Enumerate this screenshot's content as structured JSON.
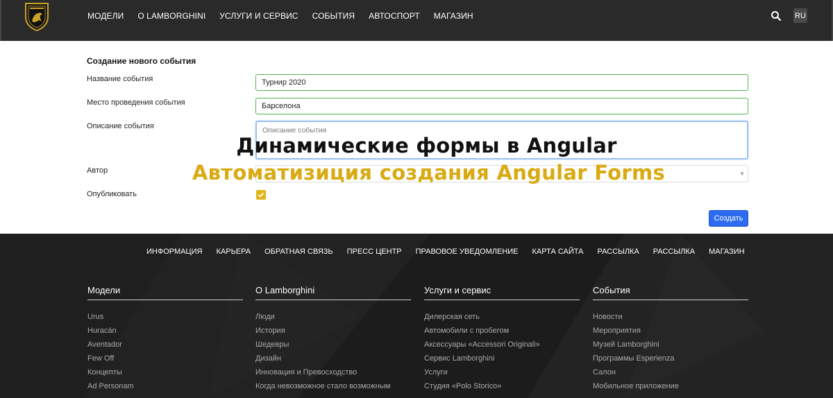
{
  "header": {
    "nav": [
      "МОДЕЛИ",
      "О LAMBORGHINI",
      "УСЛУГИ И СЕРВИС",
      "СОБЫТИЯ",
      "АВТОСПОРТ",
      "МАГАЗИН"
    ],
    "lang": "RU"
  },
  "form": {
    "title": "Создание нового события",
    "name_label": "Название события",
    "name_value": "Турнир 2020",
    "place_label": "Место проведения события",
    "place_value": "Барселона",
    "desc_label": "Описание события",
    "desc_placeholder": "Описание события",
    "author_label": "Автор",
    "publish_label": "Опубликовать",
    "publish_checked": true,
    "submit_label": "Создать"
  },
  "overlay": {
    "title": "Динамические формы в Angular",
    "subtitle": "Автоматизиция создания Angular Forms"
  },
  "footer": {
    "nav": [
      "ИНФОРМАЦИЯ",
      "КАРЬЕРА",
      "ОБРАТНАЯ СВЯЗЬ",
      "ПРЕСС ЦЕНТР",
      "ПРАВОВОЕ УВЕДОМЛЕНИЕ",
      "КАРТА САЙТА",
      "РАССЫЛКА",
      "РАССЫЛКА",
      "МАГАЗИН"
    ],
    "columns": [
      {
        "title": "Модели",
        "items": [
          "Urus",
          "Huracán",
          "Aventador",
          "Few Off",
          "Концепты",
          "Ad Personam"
        ]
      },
      {
        "title": "О Lamborghini",
        "items": [
          "Люди",
          "История",
          "Шедевры",
          "Дизайн",
          "Инновация и Превосходство",
          "Когда невозможное стало возможным"
        ]
      },
      {
        "title": "Услуги и сервис",
        "items": [
          "Дилерская сеть",
          "Автомобили с пробегом",
          "Аксессуары «Accessori Originali»",
          "Сервис Lamborghini",
          "Услуги",
          "Студия «Polo Storico»"
        ]
      },
      {
        "title": "События",
        "items": [
          "Новости",
          "Мероприятия",
          "Музей Lamborghini",
          "Программы Esperienza",
          "Салон",
          "Мобильное приложение"
        ]
      }
    ]
  },
  "colors": {
    "header_bg": "#2a2a2a",
    "accent_gold": "#d9aa12",
    "valid_border": "#52b452",
    "submit_blue": "#2d6cf0",
    "footer_bg": "#181818"
  },
  "icons": [
    "lamborghini-logo",
    "search-icon",
    "check-icon",
    "chevron-down-icon"
  ]
}
